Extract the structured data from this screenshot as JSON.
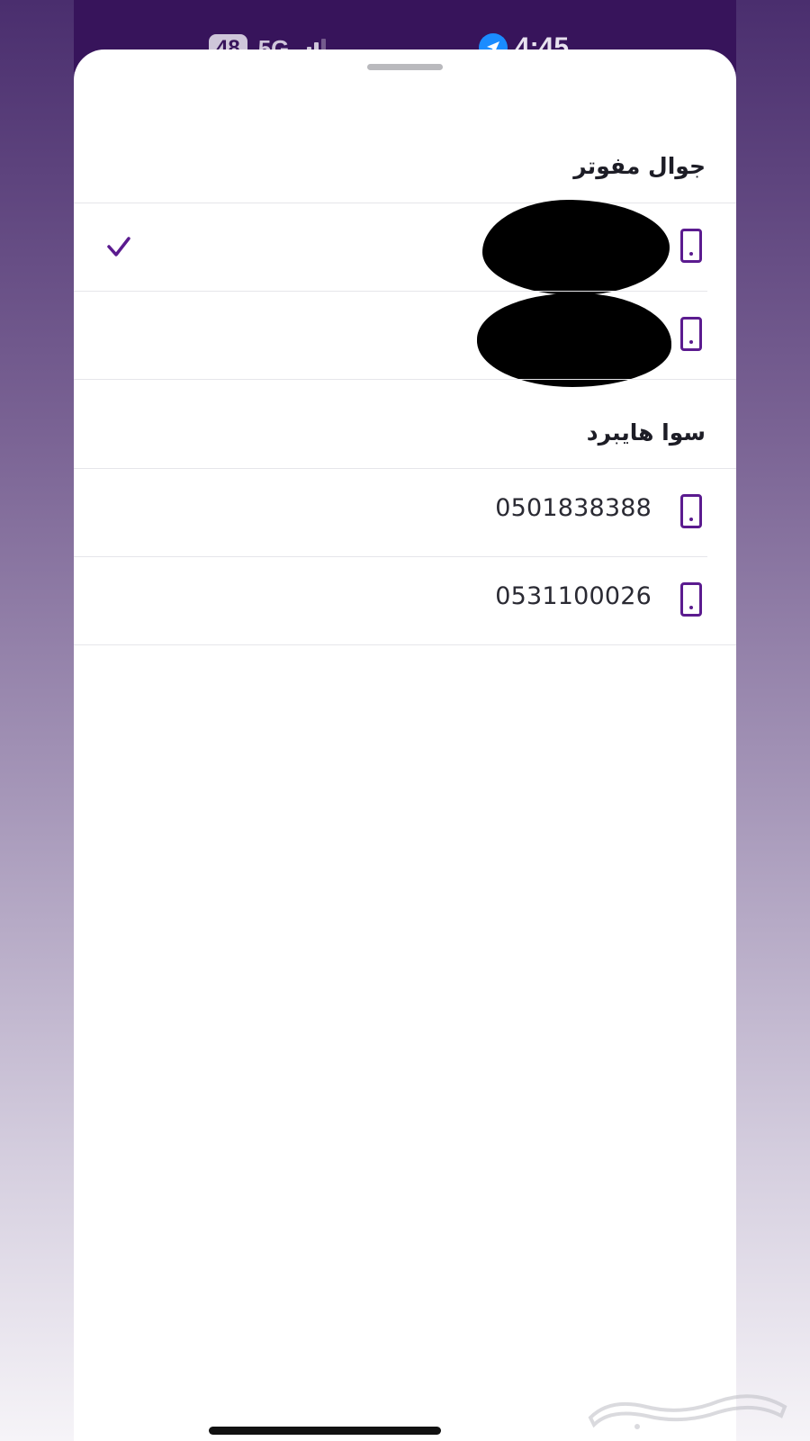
{
  "status_bar": {
    "battery": "48",
    "network": "5G",
    "time": "4:45"
  },
  "sections": [
    {
      "title": "جوال مفوتر",
      "items": [
        {
          "number": "",
          "redacted": true,
          "selected": true,
          "icon": "phone-icon"
        },
        {
          "number": "",
          "redacted": true,
          "selected": false,
          "icon": "phone-icon"
        }
      ]
    },
    {
      "title": "سوا هايبرد",
      "items": [
        {
          "number": "0501838388",
          "redacted": false,
          "selected": false,
          "icon": "phone-icon"
        },
        {
          "number": "0531100026",
          "redacted": false,
          "selected": false,
          "icon": "phone-icon"
        }
      ]
    }
  ],
  "colors": {
    "accent": "#5b1b8f",
    "header_bg": "#37145b",
    "sheet_bg": "#ffffff"
  },
  "watermark": "حراج"
}
